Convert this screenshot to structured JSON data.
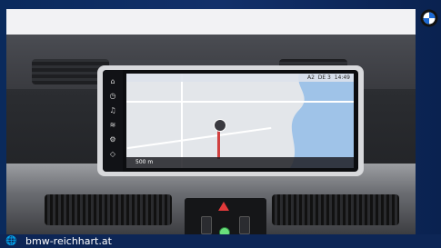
{
  "nav_screen": {
    "status_time": "14:49",
    "status_left": "A2",
    "status_date": "DE 3",
    "distance": "500 m"
  },
  "footer": {
    "website": "bmw-reichhart.at",
    "globe_icon": "globe-icon"
  },
  "brand": {
    "logo": "bmw-logo",
    "bar_color": "#0d2656"
  }
}
